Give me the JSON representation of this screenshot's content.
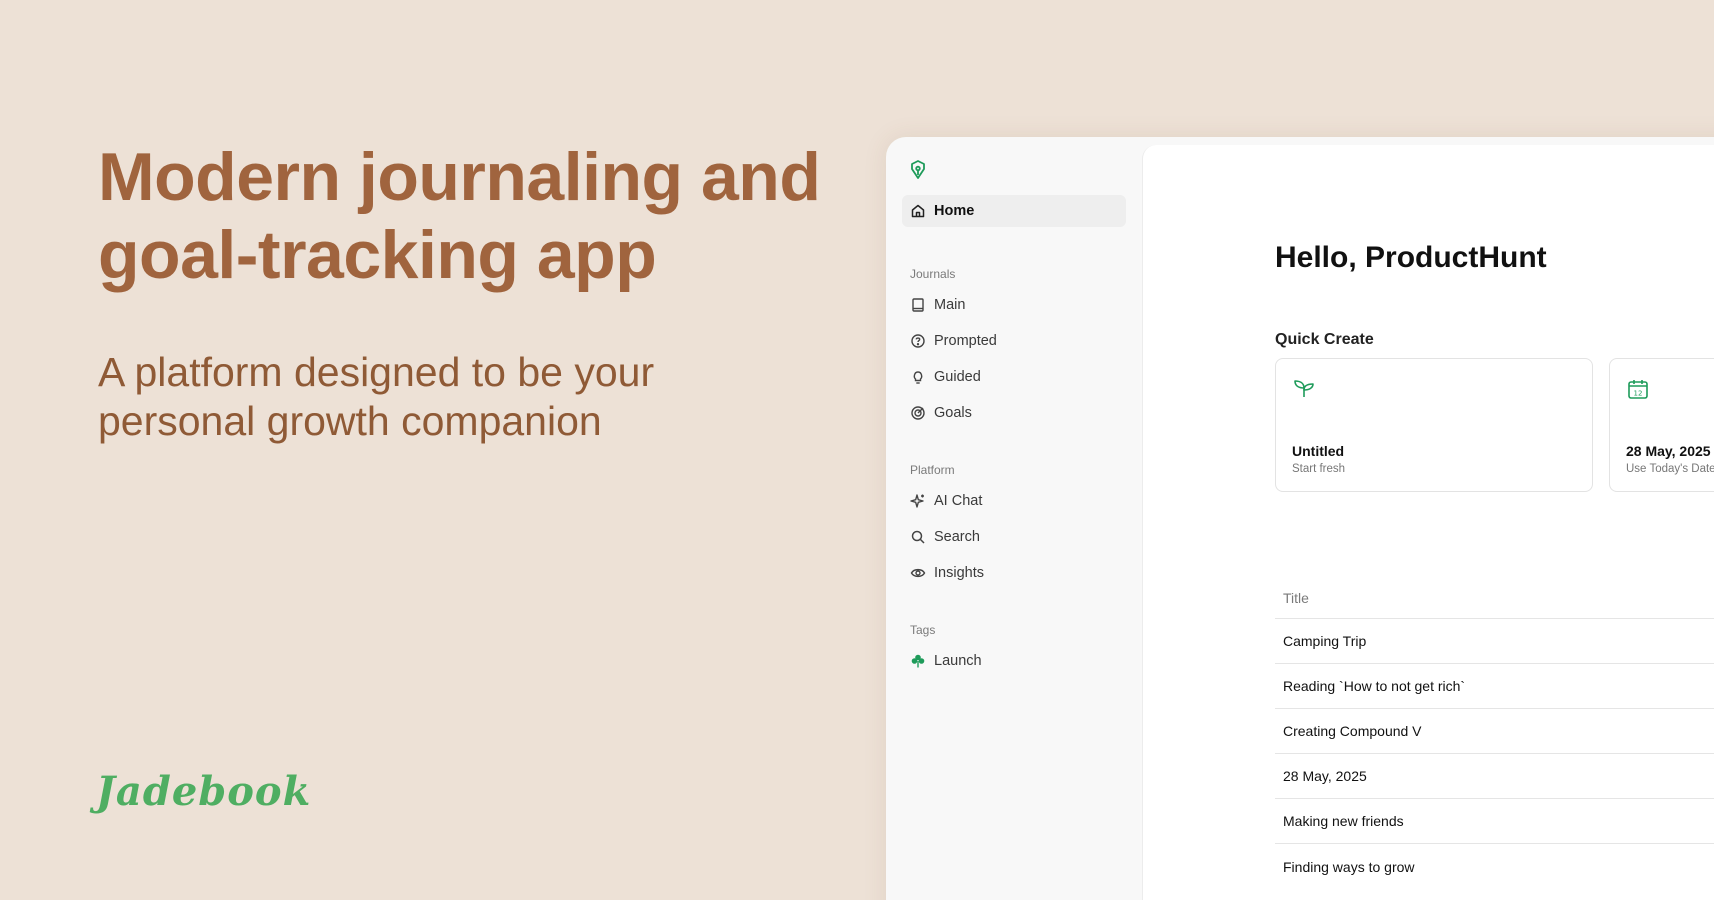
{
  "hero": {
    "headline": "Modern journaling and goal-tracking app",
    "subline": "A platform designed to be your personal growth companion",
    "brand": "Jadebook"
  },
  "colors": {
    "background": "#ede1d6",
    "headline": "#a0643e",
    "brand_green": "#4fae62",
    "accent_green": "#1e9b5a"
  },
  "sidebar": {
    "logo_icon": "pen-nib-icon",
    "home": {
      "label": "Home",
      "icon": "home-icon"
    },
    "sections": [
      {
        "label": "Journals",
        "items": [
          {
            "label": "Main",
            "icon": "book-icon"
          },
          {
            "label": "Prompted",
            "icon": "question-badge-icon"
          },
          {
            "label": "Guided",
            "icon": "lightbulb-icon"
          },
          {
            "label": "Goals",
            "icon": "target-icon"
          }
        ]
      },
      {
        "label": "Platform",
        "items": [
          {
            "label": "AI Chat",
            "icon": "sparkles-icon"
          },
          {
            "label": "Search",
            "icon": "search-icon"
          },
          {
            "label": "Insights",
            "icon": "eye-icon"
          }
        ]
      },
      {
        "label": "Tags",
        "items": [
          {
            "label": "Launch",
            "icon": "clover-icon"
          }
        ]
      }
    ]
  },
  "main": {
    "greeting": "Hello, ProductHunt",
    "quick_create": {
      "title": "Quick Create",
      "cards": [
        {
          "title": "Untitled",
          "subtitle": "Start fresh",
          "icon": "sprout-icon"
        },
        {
          "title": "28 May, 2025",
          "subtitle": "Use Today's Date",
          "icon": "calendar-icon"
        }
      ]
    },
    "table": {
      "header": "Title",
      "rows": [
        "Camping Trip",
        "Reading `How to not get rich`",
        "Creating Compound V",
        "28 May, 2025",
        "Making new friends",
        "Finding ways to grow"
      ]
    }
  }
}
